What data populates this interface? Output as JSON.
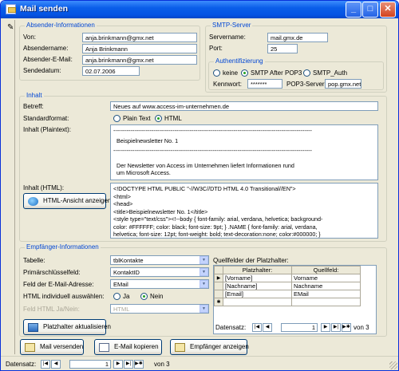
{
  "window": {
    "title": "Mail senden"
  },
  "absender": {
    "title": "Absender-Informationen",
    "von_label": "Von:",
    "von": "anja.brinkmann@gmx.net",
    "name_label": "Absendername:",
    "name": "Anja Brinkmann",
    "email_label": "Absender-E-Mail:",
    "email": "anja.brinkmann@gmx.net",
    "datum_label": "Sendedatum:",
    "datum": "02.07.2006"
  },
  "smtp": {
    "title": "SMTP-Server",
    "server_label": "Servername:",
    "server": "mail.gmx.de",
    "port_label": "Port:",
    "port": "25",
    "auth": {
      "title": "Authentifizierung",
      "opt_keine": "keine",
      "opt_pop3": "SMTP After POP3",
      "opt_auth": "SMTP_Auth",
      "selected": "SMTP After POP3",
      "kennwort_label": "Kennwort:",
      "kennwort": "*******",
      "pop3_label": "POP3-Server:",
      "pop3": "pop.gmx.net"
    }
  },
  "inhalt": {
    "title": "Inhalt",
    "betreff_label": "Betreff:",
    "betreff": "Neues auf www.access-im-unternehmen.de",
    "format_label": "Standardformat:",
    "fmt_plain": "Plain Text",
    "fmt_html": "HTML",
    "selected": "HTML",
    "plain_label": "Inhalt (Plaintext):",
    "plain_lines": [
      "--------------------------------------------------------------------------------------------------------",
      "Beispielnewsletter No. 1",
      "--------------------------------------------------------------------------------------------------------",
      "",
      "Der Newsletter von Access im Unternehmen liefert Informationen rund",
      "um Microsoft Access."
    ],
    "html_label": "Inhalt (HTML):",
    "html_button": "HTML-Ansicht anzeigen",
    "html_lines": [
      "<!DOCTYPE HTML PUBLIC \"-//W3C//DTD HTML 4.0 Transitional//EN\">",
      "<html>",
      "<head>",
      "<title>Beispielnewsletter No. 1</title>",
      "<style type=\"text/css\"><!--body { font-family: arial, verdana, helvetica; background-",
      "color: #FFFFFF; color: black; font-size: 9pt; } .NAME { font-family: arial, verdana,",
      "helvetica; font-size: 12pt; font-weight: bold; text-decoration:none; color:#000000; }"
    ]
  },
  "empf": {
    "title": "Empfänger-Informationen",
    "tabelle_label": "Tabelle:",
    "tabelle": "tblKontakte",
    "pk_label": "Primärschlüsselfeld:",
    "pk": "KontaktID",
    "feld_label": "Feld der E-Mail-Adresse:",
    "feld": "EMail",
    "html_ind_label": "HTML individuell auswählen:",
    "opt_ja": "Ja",
    "opt_nein": "Nein",
    "selected": "Nein",
    "html_ja_label": "Feld HTML Ja/Nein:",
    "html_ja": "HTML",
    "refresh_button": "Platzhalter aktualisieren",
    "quell_label": "Quellfelder der Platzhalter:",
    "columns": [
      "Platzhalter:",
      "Quellfeld:"
    ],
    "rows": [
      [
        "[Vorname]",
        "Vorname"
      ],
      [
        "[Nachname]",
        "Nachname"
      ],
      [
        "[Email]",
        "EMail"
      ]
    ],
    "nav": {
      "label": "Datensatz:",
      "current": "1",
      "total_text": "von 3"
    }
  },
  "buttons": {
    "send": "Mail versenden",
    "copy": "E-Mail kopieren",
    "show": "Empfänger anzeigen"
  },
  "status": {
    "label": "Datensatz:",
    "current": "1",
    "total_text": "von 3"
  }
}
